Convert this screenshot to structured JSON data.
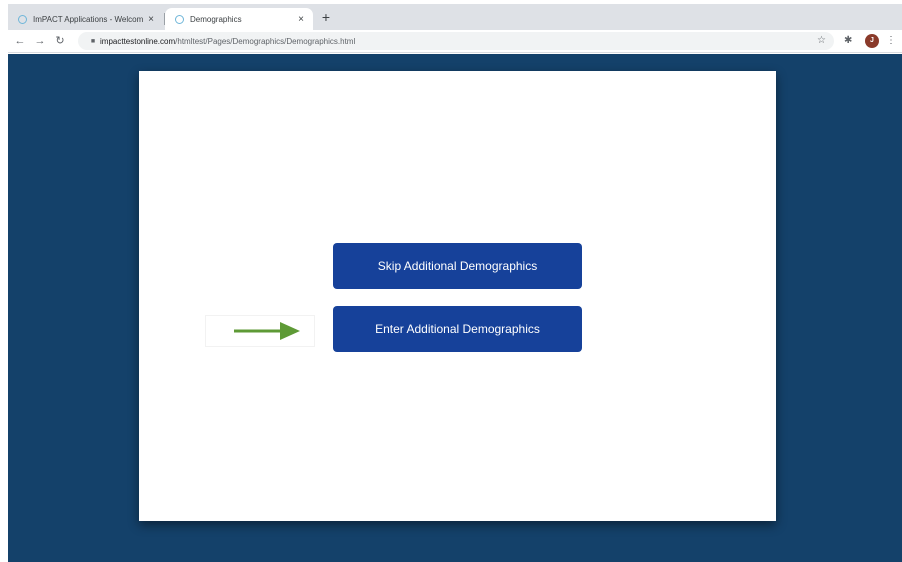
{
  "browser": {
    "tabs": [
      {
        "title": "ImPACT Applications - Welcom",
        "active": false
      },
      {
        "title": "Demographics",
        "active": true
      }
    ],
    "new_tab_symbol": "+",
    "close_symbol": "×",
    "address": {
      "domain": "impacttestonline.com",
      "path": "/htmltest/Pages/Demographics/Demographics.html"
    },
    "profile_initial": "J"
  },
  "icons": {
    "back": "back-arrow-icon",
    "forward": "forward-arrow-icon",
    "reload": "reload-icon",
    "lock": "lock-icon",
    "star": "star-icon",
    "extensions": "puzzle-icon",
    "menu": "kebab-menu-icon",
    "pointer": "right-arrow-icon"
  },
  "page": {
    "skip_button": "Skip Additional Demographics",
    "enter_button": "Enter Additional Demographics"
  },
  "colors": {
    "page_background": "#14416a",
    "button_background": "#16419a",
    "arrow": "#5e9a36"
  }
}
